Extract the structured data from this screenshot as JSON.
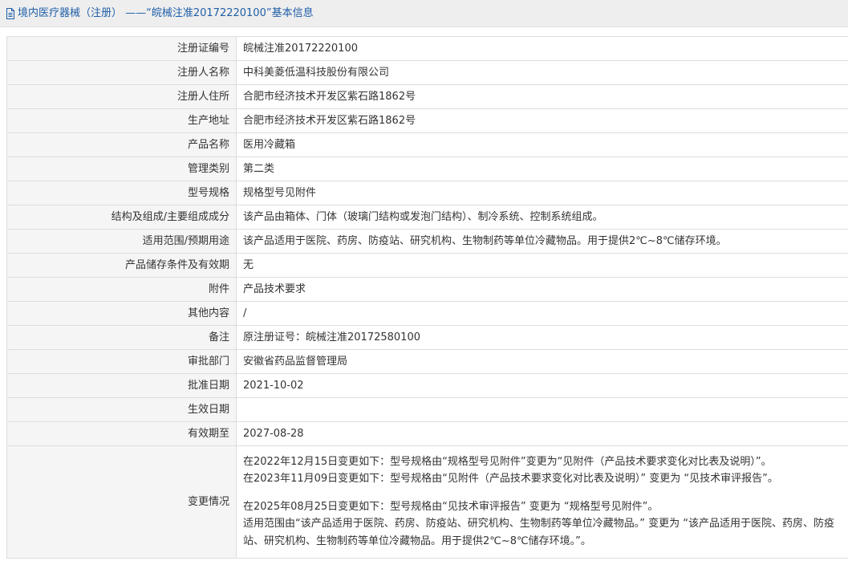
{
  "header": {
    "title": "境内医疗器械（注册） ——“皖械注准20172220100”基本信息"
  },
  "rows": [
    {
      "label": "注册证编号",
      "value": "皖械注准20172220100"
    },
    {
      "label": "注册人名称",
      "value": "中科美菱低温科技股份有限公司"
    },
    {
      "label": "注册人住所",
      "value": "合肥市经济技术开发区紫石路1862号"
    },
    {
      "label": "生产地址",
      "value": "合肥市经济技术开发区紫石路1862号"
    },
    {
      "label": "产品名称",
      "value": "医用冷藏箱"
    },
    {
      "label": "管理类别",
      "value": "第二类"
    },
    {
      "label": "型号规格",
      "value": "规格型号见附件"
    },
    {
      "label": "结构及组成/主要组成成分",
      "value": "该产品由箱体、门体（玻璃门结构或发泡门结构）、制冷系统、控制系统组成。"
    },
    {
      "label": "适用范围/预期用途",
      "value": "该产品适用于医院、药房、防疫站、研究机构、生物制药等单位冷藏物品。用于提供2℃~8℃储存环境。"
    },
    {
      "label": "产品储存条件及有效期",
      "value": "无"
    },
    {
      "label": "附件",
      "value": "产品技术要求"
    },
    {
      "label": "其他内容",
      "value": "/"
    },
    {
      "label": "备注",
      "value": "原注册证号：皖械注准20172580100"
    },
    {
      "label": "审批部门",
      "value": "安徽省药品监督管理局"
    },
    {
      "label": "批准日期",
      "value": "2021-10-02"
    },
    {
      "label": "生效日期",
      "value": ""
    },
    {
      "label": "有效期至",
      "value": "2027-08-28"
    }
  ],
  "changes": {
    "label": "变更情况",
    "line1": "在2022年12月15日变更如下：型号规格由“规格型号见附件”变更为“见附件（产品技术要求变化对比表及说明）”。",
    "line2": "在2023年11月09日变更如下：型号规格由“见附件（产品技术要求变化对比表及说明）” 变更为 “见技术审评报告”。",
    "line3": "在2025年08月25日变更如下：型号规格由“见技术审评报告” 变更为 “规格型号见附件”。",
    "line4": "适用范围由“该产品适用于医院、药房、防疫站、研究机构、生物制药等单位冷藏物品。” 变更为 “该产品适用于医院、药房、防疫站、研究机构、生物制药等单位冷藏物品。用于提供2℃~8℃储存环境。”。"
  }
}
